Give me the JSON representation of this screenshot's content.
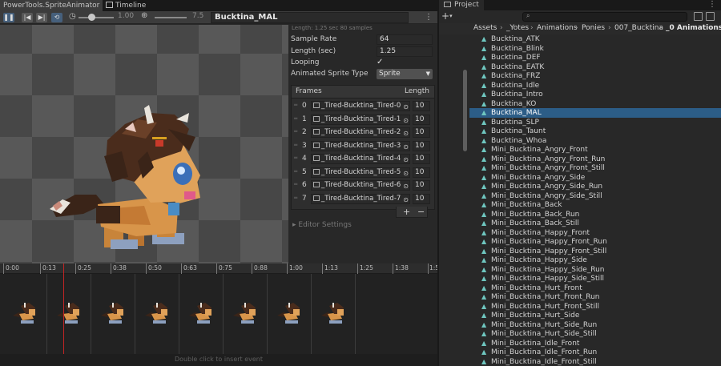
{
  "animator": {
    "tab_title": "PowerTools.SpriteAnimator",
    "tab_timeline": "Timeline",
    "toolbar": {
      "pause_icon": "pause-icon",
      "first_frame_icon": "first-frame-icon",
      "next_frame_icon": "next-frame-icon",
      "loop_icon": "loop-icon",
      "speed_value": "1.00",
      "zoom_value": "7.5",
      "animation_name": "Bucktina_MAL"
    },
    "inspector": {
      "hint": "Length: 1.25 sec  80 samples",
      "sample_rate_label": "Sample Rate",
      "sample_rate_value": "64",
      "length_label": "Length (sec)",
      "length_value": "1.25",
      "looping_label": "Looping",
      "looping_checked": "✓",
      "sprite_type_label": "Animated Sprite Type",
      "sprite_type_value": "Sprite",
      "frames_header": "Frames",
      "length_header": "Length",
      "frames": [
        {
          "index": "0",
          "sprite": "_Tired-Bucktina_Tired-0",
          "length": "10"
        },
        {
          "index": "1",
          "sprite": "_Tired-Bucktina_Tired-1",
          "length": "10"
        },
        {
          "index": "2",
          "sprite": "_Tired-Bucktina_Tired-2",
          "length": "10"
        },
        {
          "index": "3",
          "sprite": "_Tired-Bucktina_Tired-3",
          "length": "10"
        },
        {
          "index": "4",
          "sprite": "_Tired-Bucktina_Tired-4",
          "length": "10"
        },
        {
          "index": "5",
          "sprite": "_Tired-Bucktina_Tired-5",
          "length": "10"
        },
        {
          "index": "6",
          "sprite": "_Tired-Bucktina_Tired-6",
          "length": "10"
        },
        {
          "index": "7",
          "sprite": "_Tired-Bucktina_Tired-7",
          "length": "10"
        }
      ],
      "add_label": "+",
      "remove_label": "−",
      "editor_settings": "▸ Editor Settings"
    },
    "timeline": {
      "ticks": [
        "0:00",
        "0:13",
        "0:25",
        "0:38",
        "0:50",
        "0:63",
        "0:75",
        "0:88",
        "1:00",
        "1:13",
        "1:25",
        "1:38",
        "1:5"
      ],
      "footer_hint": "Double click to insert event"
    }
  },
  "project": {
    "tab_title": "Project",
    "add_label": "+",
    "breadcrumb": [
      "Assets",
      "_Yotes",
      "Animations",
      "Ponies",
      "007_Bucktina",
      "_0 Animations"
    ],
    "files": [
      "Bucktina_ATK",
      "Bucktina_Blink",
      "Bucktina_DEF",
      "Bucktina_EATK",
      "Bucktina_FRZ",
      "Bucktina_Idle",
      "Bucktina_Intro",
      "Bucktina_KO",
      "Bucktina_MAL",
      "Bucktina_SLP",
      "Bucktina_Taunt",
      "Bucktina_Whoa",
      "Mini_Bucktina_Angry_Front",
      "Mini_Bucktina_Angry_Front_Run",
      "Mini_Bucktina_Angry_Front_Still",
      "Mini_Bucktina_Angry_Side",
      "Mini_Bucktina_Angry_Side_Run",
      "Mini_Bucktina_Angry_Side_Still",
      "Mini_Bucktina_Back",
      "Mini_Bucktina_Back_Run",
      "Mini_Bucktina_Back_Still",
      "Mini_Bucktina_Happy_Front",
      "Mini_Bucktina_Happy_Front_Run",
      "Mini_Bucktina_Happy_Front_Still",
      "Mini_Bucktina_Happy_Side",
      "Mini_Bucktina_Happy_Side_Run",
      "Mini_Bucktina_Happy_Side_Still",
      "Mini_Bucktina_Hurt_Front",
      "Mini_Bucktina_Hurt_Front_Run",
      "Mini_Bucktina_Hurt_Front_Still",
      "Mini_Bucktina_Hurt_Side",
      "Mini_Bucktina_Hurt_Side_Run",
      "Mini_Bucktina_Hurt_Side_Still",
      "Mini_Bucktina_Idle_Front",
      "Mini_Bucktina_Idle_Front_Run",
      "Mini_Bucktina_Idle_Front_Still"
    ],
    "selected_file": "Bucktina_MAL",
    "file_icon": "animation-clip-icon"
  },
  "colors": {
    "selection": "#2c5d87",
    "playhead": "#c12424",
    "accent_button": "#46607c"
  }
}
